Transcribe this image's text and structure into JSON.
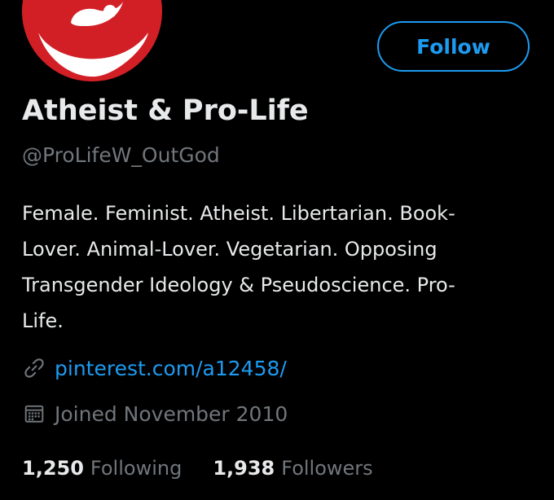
{
  "profile": {
    "display_name": "Atheist & Pro-Life",
    "handle": "@ProLifeW_OutGod",
    "bio_lines": [
      "Female. Feminist. Atheist. Libertarian. Book-",
      "Lover. Animal-Lover. Vegetarian. Opposing",
      "Transgender Ideology & Pseudoscience. Pro-",
      "Life."
    ],
    "link": "pinterest.com/a12458/",
    "joined": "Joined November 2010",
    "avatar_icon": "pro-life-logo-icon"
  },
  "actions": {
    "follow_label": "Follow"
  },
  "stats": {
    "following_count": "1,250",
    "following_label": "Following",
    "followers_count": "1,938",
    "followers_label": "Followers"
  },
  "colors": {
    "background": "#000000",
    "accent": "#1d9bf0",
    "primary_text": "#e7e9ea",
    "secondary_text": "#71767b",
    "avatar_red": "#d21f26"
  },
  "icons": {
    "link": "link-icon",
    "calendar": "calendar-icon"
  }
}
